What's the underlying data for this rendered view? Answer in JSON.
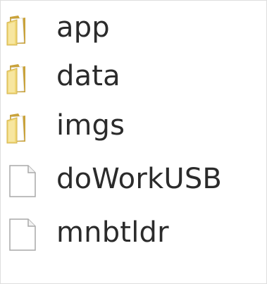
{
  "explorer": {
    "items": [
      {
        "name": "app",
        "type": "folder",
        "icon": "folder-icon"
      },
      {
        "name": "data",
        "type": "folder",
        "icon": "folder-icon"
      },
      {
        "name": "imgs",
        "type": "folder",
        "icon": "folder-icon"
      },
      {
        "name": "doWorkUSB",
        "type": "file",
        "icon": "file-icon"
      },
      {
        "name": "mnbtldr",
        "type": "file",
        "icon": "file-icon"
      }
    ]
  },
  "colors": {
    "folder_front": "#f0d878",
    "folder_back": "#c9a23a",
    "file_border": "#a9a9a9",
    "text": "#2b2b2b"
  }
}
